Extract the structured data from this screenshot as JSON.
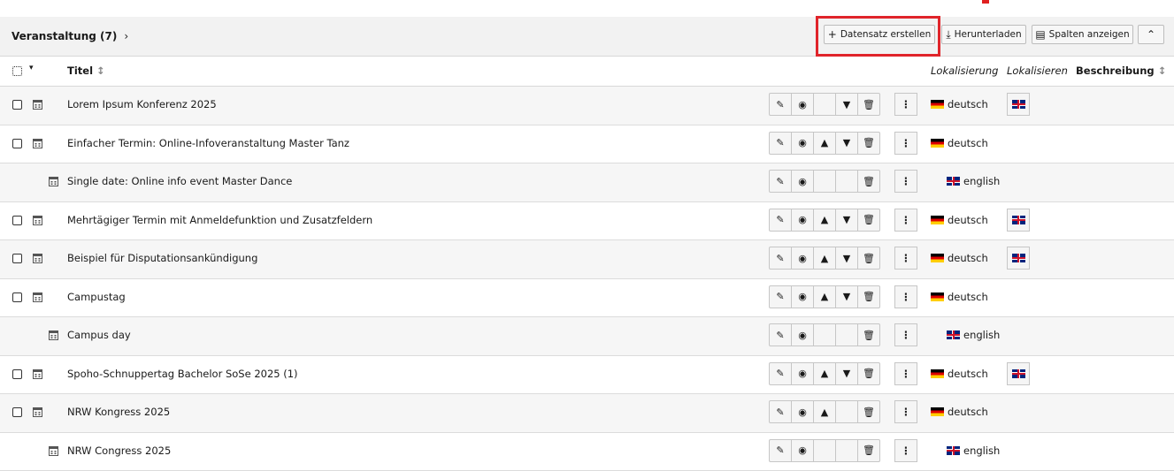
{
  "header": {
    "title": "Veranstaltung (7)",
    "create_label": "Datensatz erstellen",
    "download_label": "Herunterladen",
    "columns_label": "Spalten anzeigen"
  },
  "columns": {
    "title": "Titel",
    "localization": "Lokalisierung",
    "localize": "Lokalisieren",
    "description": "Beschreibung"
  },
  "rows": [
    {
      "title": "Lorem Ipsum Konferenz 2025",
      "lang": "deutsch"
    },
    {
      "title": "Einfacher Termin: Online-Infoveranstaltung Master Tanz",
      "lang": "deutsch"
    },
    {
      "title": "Single date: Online info event Master Dance",
      "lang": "english"
    },
    {
      "title": "Mehrtägiger Termin mit Anmeldefunktion und Zusatzfeldern",
      "lang": "deutsch"
    },
    {
      "title": "Beispiel für Disputationsankündigung",
      "lang": "deutsch"
    },
    {
      "title": "Campustag",
      "lang": "deutsch"
    },
    {
      "title": "Campus day",
      "lang": "english"
    },
    {
      "title": "Spoho-Schnuppertag Bachelor SoSe 2025 (1)",
      "lang": "deutsch"
    },
    {
      "title": "NRW Kongress 2025",
      "lang": "deutsch"
    },
    {
      "title": "NRW Congress 2025",
      "lang": "english"
    }
  ],
  "colors": {
    "highlight": "#e0242a"
  }
}
